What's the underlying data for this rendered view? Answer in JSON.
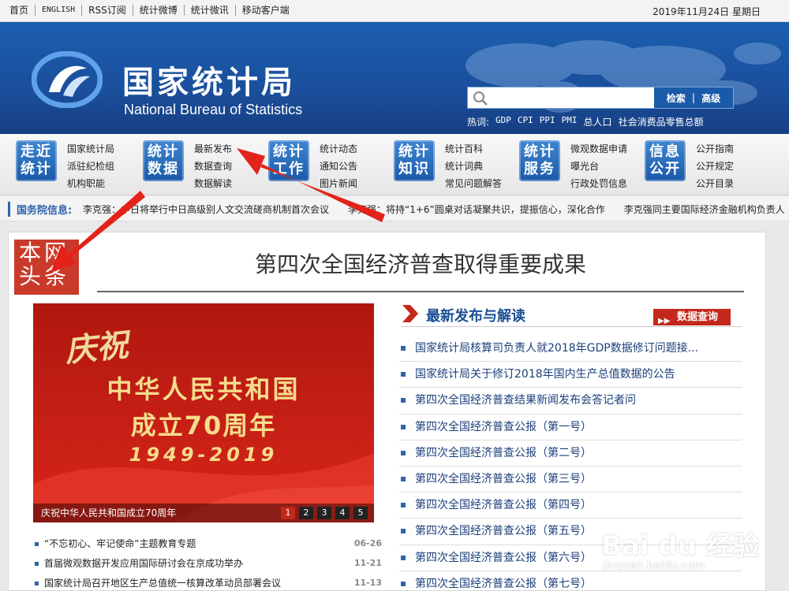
{
  "topbar": {
    "links": [
      "首页",
      "ENGLISH",
      "RSS订阅",
      "统计微博",
      "统计微讯",
      "移动客户端"
    ],
    "date": "2019年11月24日  星期日"
  },
  "header": {
    "cn_title": "国家统计局",
    "en_title": "National Bureau of Statistics",
    "search": {
      "placeholder": "",
      "btn_search": "检索",
      "btn_advanced": "高级"
    },
    "hot_label": "热词:",
    "hot_words": [
      "GDP",
      "CPI",
      "PPI",
      "PMI",
      "总人口",
      "社会消费品零售总额"
    ]
  },
  "nav": [
    {
      "box": [
        "走近",
        "统计"
      ],
      "links": [
        "国家统计局",
        "派驻纪检组",
        "机构职能"
      ]
    },
    {
      "box": [
        "统计",
        "数据"
      ],
      "links": [
        "最新发布",
        "数据查询",
        "数据解读"
      ]
    },
    {
      "box": [
        "统计",
        "工作"
      ],
      "links": [
        "统计动态",
        "通知公告",
        "图片新闻"
      ]
    },
    {
      "box": [
        "统计",
        "知识"
      ],
      "links": [
        "统计百科",
        "统计词典",
        "常见问题解答"
      ]
    },
    {
      "box": [
        "统计",
        "服务"
      ],
      "links": [
        "微观数据申请",
        "曝光台",
        "行政处罚信息"
      ]
    },
    {
      "box": [
        "信息",
        "公开"
      ],
      "links": [
        "公开指南",
        "公开规定",
        "公开目录"
      ]
    }
  ],
  "gov": {
    "label": "国务院信息:",
    "items": [
      "李克强：中日将举行中日高级别人文交流磋商机制首次会议",
      "李克强：将持“1+6”圆桌对话凝聚共识，提振信心，深化合作",
      "李克强同主要国际经济金融机构负责人"
    ]
  },
  "main": {
    "toutiao": [
      "本网",
      "头条"
    ],
    "headline": "第四次全国经济普查取得重要成果",
    "banner": {
      "line1": "庆祝",
      "line2": "中华人民共和国",
      "line3": "成立70周年",
      "line4": "1949-2019",
      "caption": "庆祝中华人民共和国成立70周年",
      "pages": [
        "1",
        "2",
        "3",
        "4",
        "5"
      ]
    },
    "left_list": [
      {
        "title": "“不忘初心、牢记使命”主题教育专题",
        "date": "06-26"
      },
      {
        "title": "首届微观数据开发应用国际研讨会在京成功举办",
        "date": "11-21"
      },
      {
        "title": "国家统计局召开地区生产总值统一核算改革动员部署会议",
        "date": "11-13"
      }
    ],
    "right_section": {
      "title": "最新发布与解读",
      "button": "数据查询",
      "items": [
        "国家统计局核算司负责人就2018年GDP数据修订问题接...",
        "国家统计局关于修订2018年国内生产总值数据的公告",
        "第四次全国经济普查结果新闻发布会答记者问",
        "第四次全国经济普查公报（第一号）",
        "第四次全国经济普查公报（第二号）",
        "第四次全国经济普查公报（第三号）",
        "第四次全国经济普查公报（第四号）",
        "第四次全国经济普查公报（第五号）",
        "第四次全国经济普查公报（第六号）",
        "第四次全国经济普查公报（第七号）"
      ]
    }
  },
  "watermark": {
    "brand": "Bai du 经验",
    "url": "jingyan.baidu.com"
  }
}
